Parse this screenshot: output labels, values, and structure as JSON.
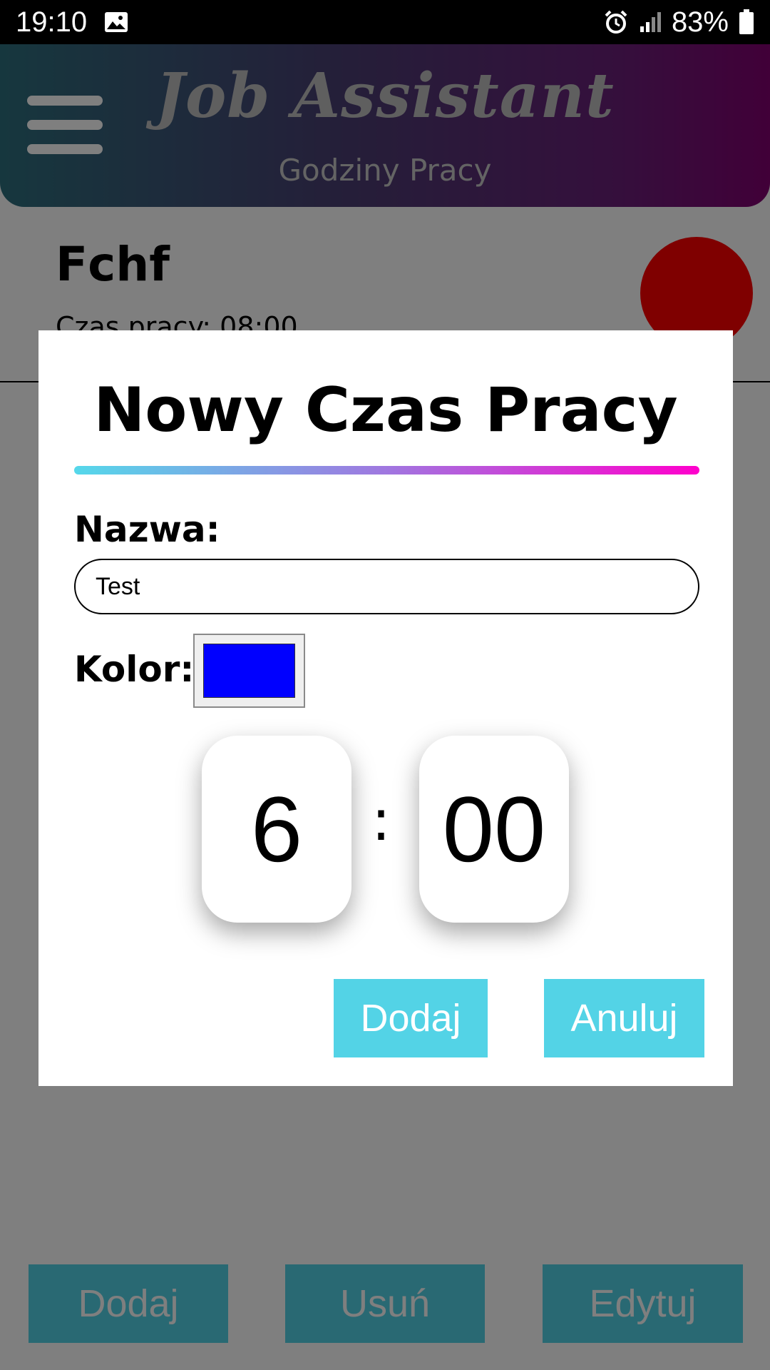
{
  "status_bar": {
    "time": "19:10",
    "battery": "83%",
    "icons": [
      "image-icon",
      "alarm-icon",
      "signal-icon",
      "battery-icon"
    ]
  },
  "header": {
    "title": "Job Assistant",
    "subtitle": "Godziny Pracy"
  },
  "list": {
    "items": [
      {
        "name": "Fchf",
        "time": "Czas pracy: 08:00",
        "color": "#ff0000"
      }
    ]
  },
  "bottom_bar": {
    "add_label": "Dodaj",
    "delete_label": "Usuń",
    "edit_label": "Edytuj"
  },
  "dialog": {
    "title": "Nowy Czas Pracy",
    "name_label": "Nazwa:",
    "name_value": "Test",
    "color_label": "Kolor:",
    "color_value": "#0000ff",
    "hours": "6",
    "separator": ":",
    "minutes": "00",
    "add_label": "Dodaj",
    "cancel_label": "Anuluj"
  },
  "colors": {
    "accent": "#53d3e6",
    "overlay": "rgba(0,0,0,0.5)"
  }
}
